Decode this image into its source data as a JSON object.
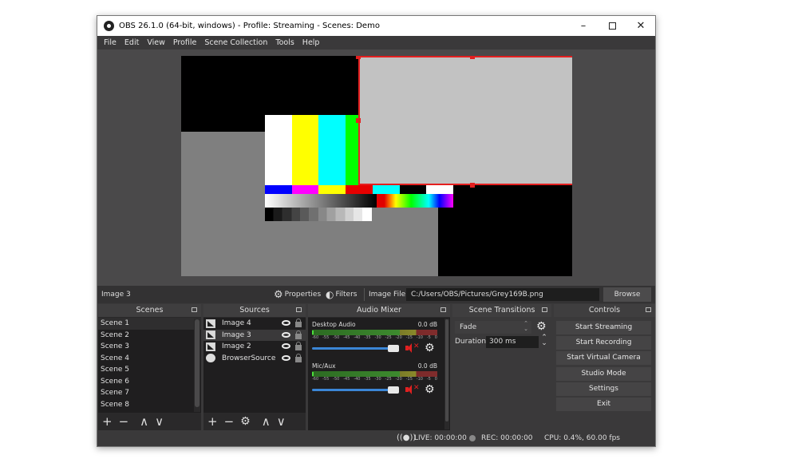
{
  "window": {
    "title": "OBS 26.1.0 (64-bit, windows) - Profile: Streaming - Scenes: Demo",
    "controls": {
      "minimize": "–",
      "close": "✕"
    }
  },
  "menu": [
    "File",
    "Edit",
    "View",
    "Profile",
    "Scene Collection",
    "Tools",
    "Help"
  ],
  "source_toolbar": {
    "current_source": "Image 3",
    "properties_label": "Properties",
    "filters_label": "Filters",
    "image_file_label": "Image File",
    "image_file_value": "C:/Users/OBS/Pictures/Grey169B.png",
    "browse_label": "Browse"
  },
  "preview": {
    "selected_source": "Image 3",
    "selection_color": "#e41f1f",
    "color_bars_top": [
      "#ffffff",
      "#ffff00",
      "#00ffff",
      "#00ff00",
      "#ff00ff",
      "#e60000",
      "#0000ff"
    ],
    "color_bars_mid": [
      "#0000ff",
      "#ff00ff",
      "#ffff00",
      "#e60000",
      "#00ffff",
      "#000000",
      "#ffffff"
    ]
  },
  "scenes": {
    "title": "Scenes",
    "items": [
      "Scene 1",
      "Scene 2",
      "Scene 3",
      "Scene 4",
      "Scene 5",
      "Scene 6",
      "Scene 7",
      "Scene 8"
    ],
    "selected": "Scene 1",
    "footer": {
      "add": "+",
      "remove": "−",
      "up": "∧",
      "down": "∨"
    }
  },
  "sources": {
    "title": "Sources",
    "items": [
      {
        "name": "Image 4",
        "type": "image",
        "visible": true,
        "locked": false
      },
      {
        "name": "Image 3",
        "type": "image",
        "visible": true,
        "locked": false
      },
      {
        "name": "Image 2",
        "type": "image",
        "visible": true,
        "locked": false
      },
      {
        "name": "BrowserSource",
        "type": "browser",
        "visible": true,
        "locked": false
      }
    ],
    "selected": "Image 3",
    "footer": {
      "add": "+",
      "remove": "−",
      "settings": "⚙",
      "up": "∧",
      "down": "∨"
    }
  },
  "audio_mixer": {
    "title": "Audio Mixer",
    "ticks": [
      "-60",
      "-55",
      "-50",
      "-45",
      "-40",
      "-35",
      "-30",
      "-25",
      "-20",
      "-15",
      "-10",
      "-5",
      "0"
    ],
    "channels": [
      {
        "name": "Desktop Audio",
        "db": "0.0 dB",
        "volume_percent": 100,
        "muted": true
      },
      {
        "name": "Mic/Aux",
        "db": "0.0 dB",
        "volume_percent": 100,
        "muted": true
      }
    ],
    "mute_color": "#e02020"
  },
  "scene_transitions": {
    "title": "Scene Transitions",
    "transition": "Fade",
    "duration_label": "Duration",
    "duration_value": "300 ms"
  },
  "controls": {
    "title": "Controls",
    "buttons": [
      "Start Streaming",
      "Start Recording",
      "Start Virtual Camera",
      "Studio Mode",
      "Settings",
      "Exit"
    ]
  },
  "status": {
    "live": "LIVE: 00:00:00",
    "rec": "REC: 00:00:00",
    "cpu": "CPU: 0.4%, 60.00 fps"
  }
}
